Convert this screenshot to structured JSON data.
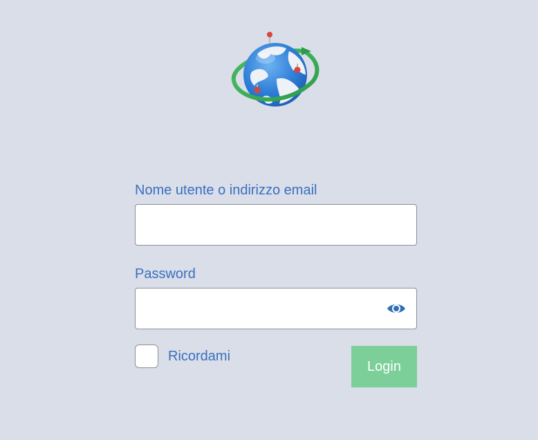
{
  "logo": {
    "icon": "globe-with-orbit-icon"
  },
  "form": {
    "username_label": "Nome utente o indirizzo email",
    "username_value": "",
    "password_label": "Password",
    "password_value": "",
    "remember_label": "Ricordami",
    "remember_checked": false,
    "login_label": "Login"
  },
  "colors": {
    "background": "#d9dee8",
    "label": "#3a6fbf",
    "login_button": "#7ccf98",
    "input_border": "#8c8f94"
  }
}
